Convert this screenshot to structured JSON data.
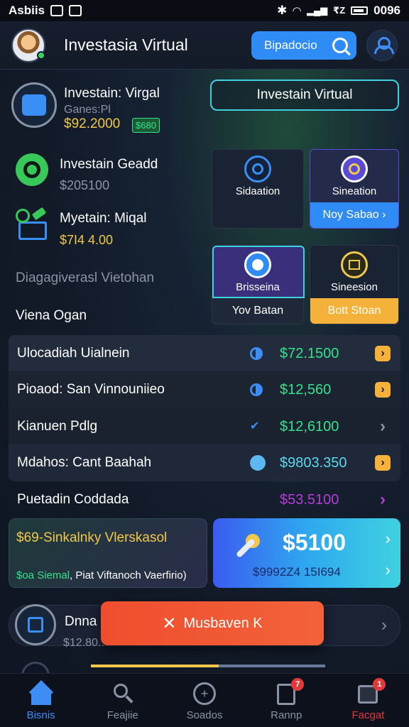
{
  "status_bar": {
    "left_text": "Asbiis",
    "right_text": "0096",
    "signal_text": "₹Z"
  },
  "header": {
    "title": "Investasia Virtual",
    "search_label": "Bipadocio"
  },
  "portfolio": {
    "name": "Investain: Virgal",
    "sub": "Ganes:Pl",
    "value": "$92.2000",
    "badge": "$680",
    "cta_label": "Investain Virtual"
  },
  "assets": [
    {
      "name": "Investain Geadd",
      "value": "$205100"
    },
    {
      "name": "Myetain: Miqal",
      "value": "$7I4 4.00"
    }
  ],
  "section_label": "Diagagiverasl Vietohan",
  "subheading": "Viena Ogan",
  "tiles": [
    {
      "label": "Sidaation",
      "button": "",
      "icon": "target-icon"
    },
    {
      "label": "Sineation",
      "button": "Noy Sabao ›",
      "icon": "ring-icon"
    },
    {
      "label": "Brisseina",
      "button": "Yov Batan",
      "icon": "globe-icon"
    },
    {
      "label": "Sineesion",
      "button": "Bott Stoan",
      "icon": "document-icon"
    }
  ],
  "list_rows": [
    {
      "name": "Ulocadiah Uialnein",
      "amount": "$72.1500",
      "amount_color": "#33e28a",
      "indicator": "half-circle-icon",
      "chevron_style": "yellow"
    },
    {
      "name": "Pioaod: San Vinnouniieo",
      "amount": "$12,560",
      "amount_color": "#33e28a",
      "indicator": "half-circle-icon",
      "chevron_style": "yellow"
    },
    {
      "name": "Kianuen Pdlg",
      "amount": "$12,6100",
      "amount_color": "#33e28a",
      "indicator": "check-icon",
      "chevron_style": "plain"
    },
    {
      "name": "Mdahos: Cant Baahah",
      "amount": "$9803.350",
      "amount_color": "#5bd8f0",
      "indicator": "blob-icon",
      "chevron_style": "yellow"
    },
    {
      "name": "Puetadin Coddada",
      "amount": "$53.5100",
      "amount_color": "#b63ad8",
      "indicator": "",
      "chevron_style": "purple"
    }
  ],
  "promo_left": {
    "title": "$69-Sinkalnky Vlerskasol",
    "green_text": "$oa Siemal",
    "sub_text": ", Piat Viftanoch Vaerfirio)"
  },
  "promo_right": {
    "amount": "$5100",
    "sub_amount": "$9992Z4 15I694"
  },
  "bottom_card": {
    "title": "Dnna",
    "value": "$12.80.."
  },
  "floating_button": {
    "label": "Musbaven K"
  },
  "nav": [
    {
      "label": "Bisnis",
      "icon": "home-icon",
      "active": true,
      "badge": ""
    },
    {
      "label": "Feajiie",
      "icon": "search-icon",
      "active": false,
      "badge": ""
    },
    {
      "label": "Soados",
      "icon": "compass-icon",
      "active": false,
      "badge": ""
    },
    {
      "label": "Rannp",
      "icon": "report-icon",
      "active": false,
      "badge": "7"
    },
    {
      "label": "Facgat",
      "icon": "inbox-icon",
      "active": false,
      "badge": "1"
    }
  ],
  "colors": {
    "accent_blue": "#2f8cf4",
    "accent_green": "#33e28a",
    "accent_yellow": "#f1c84a",
    "accent_cyan": "#3fd1e0",
    "danger": "#e23a3a"
  }
}
